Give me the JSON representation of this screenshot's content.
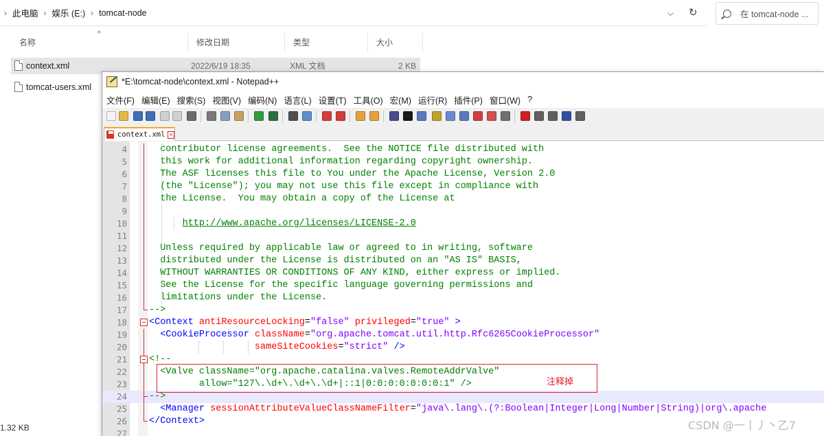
{
  "explorer": {
    "breadcrumb": [
      "此电脑",
      "娱乐 (E:)",
      "tomcat-node"
    ],
    "search_placeholder": "在 tomcat-node ...",
    "columns": [
      "名称",
      "修改日期",
      "类型",
      "大小"
    ],
    "files": [
      {
        "name": "context.xml",
        "date": "2022/6/19 18:35",
        "type": "XML 文档",
        "size": "2 KB"
      },
      {
        "name": "tomcat-users.xml"
      }
    ],
    "status": "1.32 KB"
  },
  "npp": {
    "title": "*E:\\tomcat-node\\context.xml - Notepad++",
    "menu": [
      "文件(F)",
      "编辑(E)",
      "搜索(S)",
      "视图(V)",
      "编码(N)",
      "语言(L)",
      "设置(T)",
      "工具(O)",
      "宏(M)",
      "运行(R)",
      "插件(P)",
      "窗口(W)",
      "?"
    ],
    "tab": "context.xml",
    "lines": [
      {
        "n": "4",
        "segs": [
          {
            "c": "comment",
            "t": "  contributor license agreements.  See the NOTICE file distributed with"
          }
        ]
      },
      {
        "n": "5",
        "segs": [
          {
            "c": "comment",
            "t": "  this work for additional information regarding copyright ownership."
          }
        ]
      },
      {
        "n": "6",
        "segs": [
          {
            "c": "comment",
            "t": "  The ASF licenses this file to You under the Apache License, Version 2.0"
          }
        ]
      },
      {
        "n": "7",
        "segs": [
          {
            "c": "comment",
            "t": "  (the \"License\"); you may not use this file except in compliance with"
          }
        ]
      },
      {
        "n": "8",
        "segs": [
          {
            "c": "comment",
            "t": "  the License.  You may obtain a copy of the License at"
          }
        ]
      },
      {
        "n": "9",
        "segs": []
      },
      {
        "n": "10",
        "segs": [
          {
            "c": "comment",
            "t": "      "
          },
          {
            "c": "url",
            "t": "http://www.apache.org/licenses/LICENSE-2.0"
          }
        ]
      },
      {
        "n": "11",
        "segs": []
      },
      {
        "n": "12",
        "segs": [
          {
            "c": "comment",
            "t": "  Unless required by applicable law or agreed to in writing, software"
          }
        ]
      },
      {
        "n": "13",
        "segs": [
          {
            "c": "comment",
            "t": "  distributed under the License is distributed on an \"AS IS\" BASIS,"
          }
        ]
      },
      {
        "n": "14",
        "segs": [
          {
            "c": "comment",
            "t": "  WITHOUT WARRANTIES OR CONDITIONS OF ANY KIND, either express or implied."
          }
        ]
      },
      {
        "n": "15",
        "segs": [
          {
            "c": "comment",
            "t": "  See the License for the specific language governing permissions and"
          }
        ]
      },
      {
        "n": "16",
        "segs": [
          {
            "c": "comment",
            "t": "  limitations under the License."
          }
        ]
      },
      {
        "n": "17",
        "segs": [
          {
            "c": "comment",
            "t": "-->"
          }
        ]
      },
      {
        "n": "18",
        "segs": [
          {
            "c": "tag",
            "t": "<Context "
          },
          {
            "c": "attr",
            "t": "antiResourceLocking"
          },
          {
            "c": "eq",
            "t": "="
          },
          {
            "c": "val",
            "t": "\"false\""
          },
          {
            "c": "attr",
            "t": " privileged"
          },
          {
            "c": "eq",
            "t": "="
          },
          {
            "c": "val",
            "t": "\"true\""
          },
          {
            "c": "tag",
            "t": " >"
          }
        ]
      },
      {
        "n": "19",
        "segs": [
          {
            "c": "tag",
            "t": "  <CookieProcessor "
          },
          {
            "c": "attr",
            "t": "className"
          },
          {
            "c": "eq",
            "t": "="
          },
          {
            "c": "val",
            "t": "\"org.apache.tomcat.util.http.Rfc6265CookieProcessor\""
          }
        ]
      },
      {
        "n": "20",
        "segs": [
          {
            "c": "attr",
            "t": "                   sameSiteCookies"
          },
          {
            "c": "eq",
            "t": "="
          },
          {
            "c": "val",
            "t": "\"strict\""
          },
          {
            "c": "tag",
            "t": " />"
          }
        ]
      },
      {
        "n": "21",
        "segs": [
          {
            "c": "comment",
            "t": "<!--"
          }
        ]
      },
      {
        "n": "22",
        "segs": [
          {
            "c": "comment",
            "t": "  <Valve className=\"org.apache.catalina.valves.RemoteAddrValve\""
          }
        ]
      },
      {
        "n": "23",
        "segs": [
          {
            "c": "comment",
            "t": "         allow=\"127\\.\\d+\\.\\d+\\.\\d+|::1|0:0:0:0:0:0:0:1\" />"
          }
        ]
      },
      {
        "n": "24",
        "segs": [
          {
            "c": "comment",
            "t": "-->"
          }
        ]
      },
      {
        "n": "25",
        "segs": [
          {
            "c": "tag",
            "t": "  <Manager "
          },
          {
            "c": "attr",
            "t": "sessionAttributeValueClassNameFilter"
          },
          {
            "c": "eq",
            "t": "="
          },
          {
            "c": "val",
            "t": "\"java\\.lang\\.(?:Boolean|Integer|Long|Number|String)|org\\.apache"
          }
        ]
      },
      {
        "n": "26",
        "segs": [
          {
            "c": "tag",
            "t": "</Context>"
          }
        ]
      },
      {
        "n": "27",
        "segs": []
      }
    ],
    "annotation": "注释掉"
  },
  "watermark": "CSDN @一丨丿丶乙7"
}
